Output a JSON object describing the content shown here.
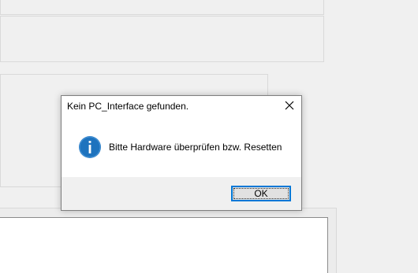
{
  "dialog": {
    "title": "Kein PC_Interface gefunden.",
    "message": "Bitte Hardware überprüfen bzw. Resetten",
    "ok_label": "OK",
    "icon": "info-icon",
    "close_icon": "close-icon"
  },
  "colors": {
    "accent": "#0078d7",
    "info_icon_fill": "#1e73be",
    "background": "#f0f0f0"
  }
}
